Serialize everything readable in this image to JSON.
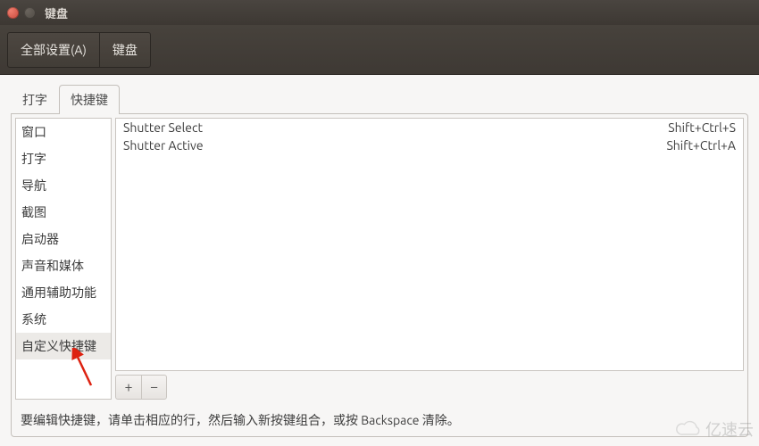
{
  "window": {
    "title": "键盘"
  },
  "toolbar": {
    "all_settings": "全部设置(A)",
    "keyboard": "键盘"
  },
  "tabs": {
    "typing": "打字",
    "shortcuts": "快捷键"
  },
  "sidebar": {
    "items": [
      {
        "label": "窗口"
      },
      {
        "label": "打字"
      },
      {
        "label": "导航"
      },
      {
        "label": "截图"
      },
      {
        "label": "启动器"
      },
      {
        "label": "声音和媒体"
      },
      {
        "label": "通用辅助功能"
      },
      {
        "label": "系统"
      },
      {
        "label": "自定义快捷键"
      }
    ],
    "selected_index": 8
  },
  "shortcuts": [
    {
      "name": "Shutter Select",
      "accel": "Shift+Ctrl+S"
    },
    {
      "name": "Shutter Active",
      "accel": "Shift+Ctrl+A"
    }
  ],
  "buttons": {
    "add": "+",
    "remove": "−"
  },
  "hint": "要编辑快捷键，请单击相应的行，然后输入新按键组合，或按 Backspace 清除。",
  "watermark": "亿速云"
}
